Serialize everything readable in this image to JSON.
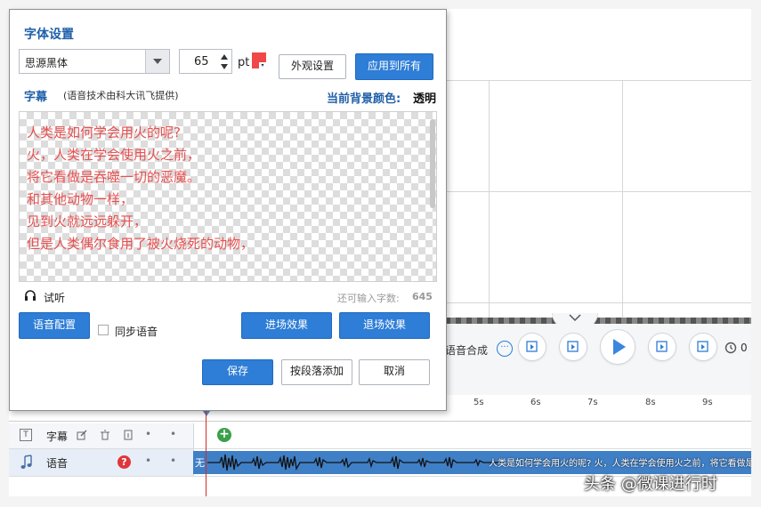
{
  "dialog": {
    "title": "字体设置",
    "font_name": "思源黑体",
    "font_size": "65",
    "font_unit": "pt",
    "font_color": "#f04848",
    "appearance_button": "外观设置",
    "apply_all_button": "应用到所有",
    "subtitle_label": "字幕",
    "subtitle_note": "(语音技术由科大讯飞提供)",
    "bg_color_label": "当前背景颜色:",
    "bg_color_value": "透明",
    "preview_lines": [
      "人类是如何学会用火的呢?",
      "火，人类在学会使用火之前，",
      "将它看做是吞噬一切的恶魔。",
      "和其他动物一样，",
      "见到火就远远躲开，",
      "但是人类偶尔食用了被火烧死的动物，"
    ],
    "listen_label": "试听",
    "remaining_label": "还可输入字数:",
    "remaining_count": "645",
    "voice_config_button": "语音配置",
    "sync_voice_label": "同步语音",
    "enter_effect_button": "进场效果",
    "exit_effect_button": "退场效果",
    "save_button": "保存",
    "add_by_paragraph_button": "按段落添加",
    "cancel_button": "取消"
  },
  "editor": {
    "speech_synthesis_label": "语音合成",
    "time_partial": "0",
    "ruler_ticks": [
      "5s",
      "6s",
      "7s",
      "8s",
      "9s"
    ],
    "tracks": [
      {
        "name": "字幕"
      },
      {
        "name": "语音",
        "clip_start": "无",
        "clip_text": "人类是如何学会用火的呢?  火，人类在学会使用火之前，将它看做是"
      }
    ]
  },
  "watermark": "头条 @微课进行时"
}
